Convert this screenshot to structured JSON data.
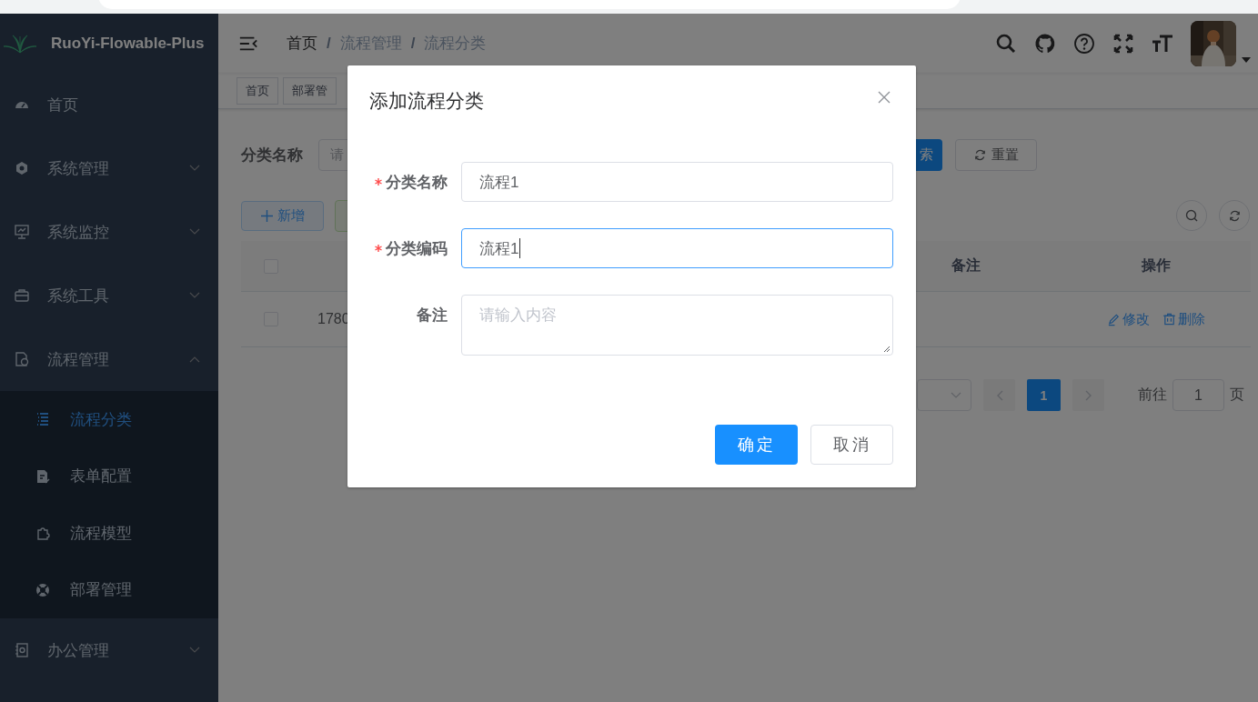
{
  "sidebar": {
    "logo_title": "RuoYi-Flowable-Plus",
    "menu": [
      {
        "kind": "item",
        "label": "首页"
      },
      {
        "kind": "group",
        "label": "系统管理",
        "expanded": false
      },
      {
        "kind": "group",
        "label": "系统监控",
        "expanded": false
      },
      {
        "kind": "group",
        "label": "系统工具",
        "expanded": false
      },
      {
        "kind": "group",
        "label": "流程管理",
        "expanded": true,
        "children": [
          {
            "label": "流程分类",
            "selected": true
          },
          {
            "label": "表单配置",
            "selected": false
          },
          {
            "label": "流程模型",
            "selected": false
          },
          {
            "label": "部署管理",
            "selected": false
          }
        ]
      },
      {
        "kind": "group",
        "label": "办公管理",
        "expanded": false
      }
    ]
  },
  "navbar": {
    "separator": "/",
    "breadcrumb": [
      {
        "label": "首页",
        "link": true
      },
      {
        "label": "流程管理",
        "link": false
      },
      {
        "label": "流程分类",
        "link": false
      }
    ]
  },
  "tags": [
    "首页",
    "部署管"
  ],
  "search": {
    "label": "分类名称",
    "placeholder": "请",
    "search_button": "索",
    "reset_button": "重置"
  },
  "toolbar": {
    "add_button": "新增"
  },
  "table": {
    "columns": [
      {
        "kind": "checkbox",
        "checked": false
      },
      {
        "kind": "blank"
      },
      {
        "kind": "text",
        "label": "备注"
      },
      {
        "kind": "text",
        "label": "操作"
      }
    ],
    "rows": [
      {
        "checked": false,
        "cells": [
          "1780"
        ],
        "actions": [
          "修改",
          "删除"
        ]
      }
    ]
  },
  "pagination": {
    "pages": [
      {
        "label": "1",
        "selected": true
      }
    ],
    "goto_label": "前往",
    "goto_value": "1",
    "page_suffix": "页"
  },
  "dialog": {
    "title": "添加流程分类",
    "fields": [
      {
        "kind": "input",
        "label": "分类名称",
        "required": true,
        "value": "流程1",
        "focused": false
      },
      {
        "kind": "input",
        "label": "分类编码",
        "required": true,
        "value": "流程1",
        "focused": true
      },
      {
        "kind": "textarea",
        "label": "备注",
        "required": false,
        "placeholder": "请输入内容",
        "focused": false
      }
    ],
    "buttons": [
      {
        "kind": "primary",
        "label": "确定"
      },
      {
        "kind": "default",
        "label": "取消"
      }
    ]
  }
}
